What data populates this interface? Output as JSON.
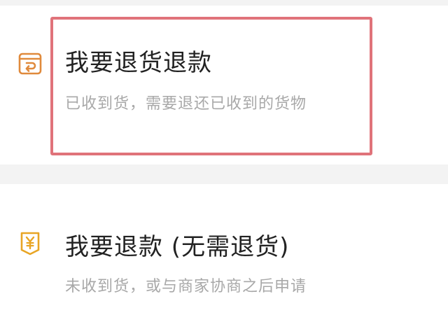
{
  "options": [
    {
      "title": "我要退货退款",
      "description": "已收到货，需要退还已收到的货物",
      "icon": "return-box-icon",
      "highlighted": true
    },
    {
      "title": "我要退款 (无需退货)",
      "description": "未收到货，或与商家协商之后申请",
      "icon": "yuan-refund-icon",
      "highlighted": false
    }
  ],
  "colors": {
    "icon_orange": "#e08a3c",
    "icon_gold": "#e8a525",
    "highlight_border": "#e0737a",
    "title_text": "#222222",
    "desc_text": "#a8a8a8",
    "separator": "#f3f3f3"
  }
}
